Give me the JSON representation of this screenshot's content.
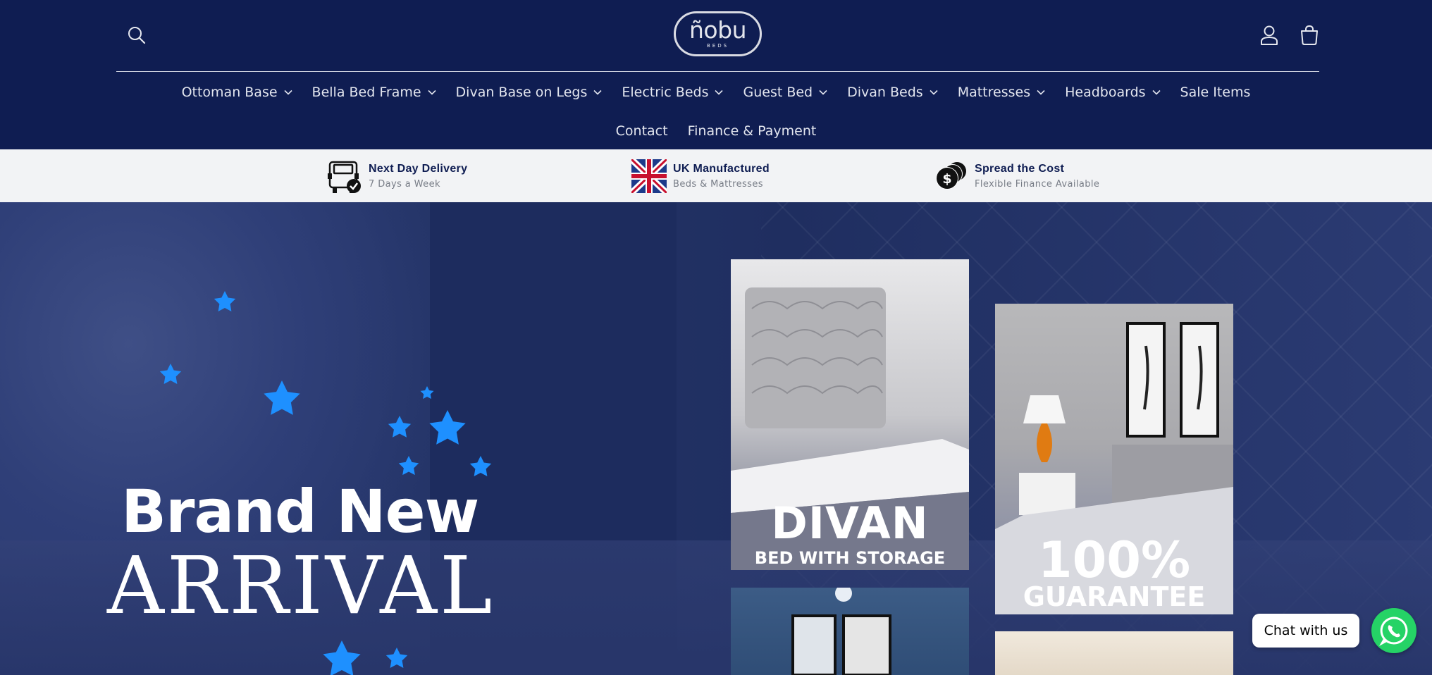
{
  "header": {
    "logo_word": "ñobu",
    "logo_sub": "BEDS"
  },
  "icons": {
    "search": "search-icon",
    "account": "user-icon",
    "cart": "cart-icon",
    "chevron": "chevron-down-icon",
    "delivery": "van-icon",
    "uk": "union-jack-icon",
    "finance": "coins-icon",
    "whatsapp": "whatsapp-icon"
  },
  "nav": {
    "row1": [
      {
        "label": "Ottoman Base",
        "dropdown": true
      },
      {
        "label": "Bella Bed Frame",
        "dropdown": true
      },
      {
        "label": "Divan Base on Legs",
        "dropdown": true
      },
      {
        "label": "Electric Beds",
        "dropdown": true
      },
      {
        "label": "Guest Bed",
        "dropdown": true
      },
      {
        "label": "Divan Beds",
        "dropdown": true
      },
      {
        "label": "Mattresses",
        "dropdown": true
      },
      {
        "label": "Headboards",
        "dropdown": true
      },
      {
        "label": "Sale Items",
        "dropdown": false
      }
    ],
    "row2": [
      {
        "label": "Contact"
      },
      {
        "label": "Finance & Payment"
      }
    ]
  },
  "usp": [
    {
      "title": "Next Day Delivery",
      "subtitle": "7 Days a Week"
    },
    {
      "title": "UK Manufactured",
      "subtitle": "Beds & Mattresses"
    },
    {
      "title": "Spread the Cost",
      "subtitle": "Flexible Finance Available"
    }
  ],
  "hero": {
    "line1": "Brand New",
    "line2": "ARRIVAL",
    "tiles": {
      "divan_big": "DIVAN",
      "divan_small": "BED WITH STORAGE",
      "guarantee_big": "100%",
      "guarantee_small": "GUARANTEE"
    }
  },
  "chat": {
    "label": "Chat with us"
  },
  "colors": {
    "navy": "#0f1d52",
    "usp_bg": "#f2f3f5",
    "star_blue": "#1e90ff",
    "whatsapp_green": "#25d366"
  }
}
